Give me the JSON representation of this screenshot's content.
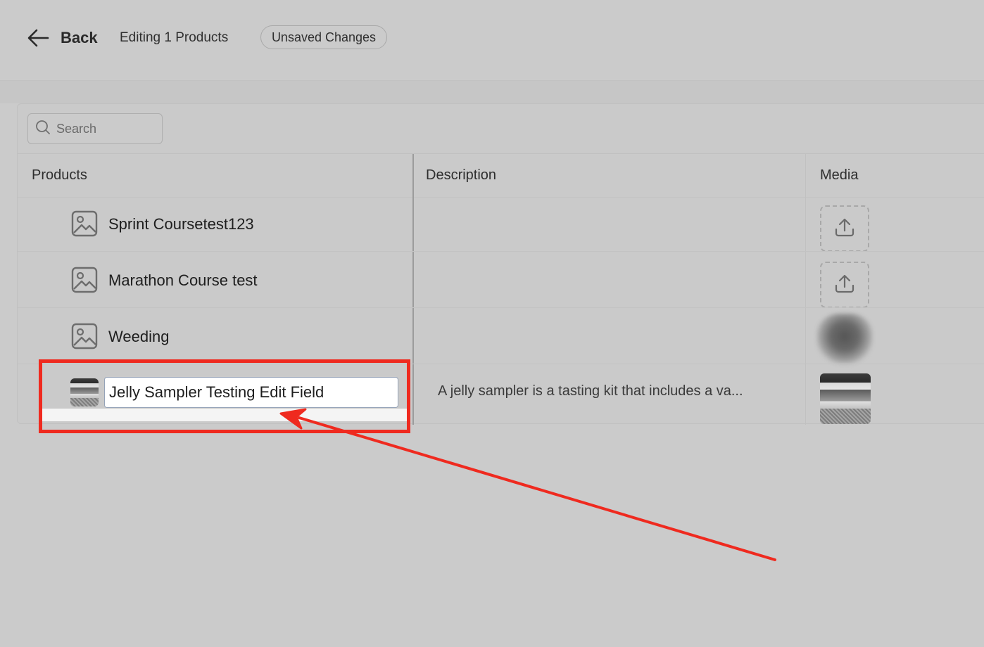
{
  "header": {
    "back_label": "Back",
    "editing_label": "Editing 1 Products",
    "status_badge": "Unsaved Changes"
  },
  "search": {
    "placeholder": "Search"
  },
  "table": {
    "columns": [
      "Products",
      "Description",
      "Media"
    ],
    "rows": [
      {
        "name": "Sprint Coursetest123",
        "description": "",
        "media": "upload-icon"
      },
      {
        "name": "Marathon Course test",
        "description": "",
        "media": "upload-icon"
      },
      {
        "name": "Weeding",
        "description": "",
        "media": "blurred-product-photo"
      },
      {
        "name": "Jelly Sampler Testing Edit Field",
        "description": "A jelly sampler is a tasting kit that includes a va...",
        "media": "jelly-jars-photo"
      }
    ]
  },
  "annotation": {
    "highlight_color": "#ef2a1f"
  }
}
